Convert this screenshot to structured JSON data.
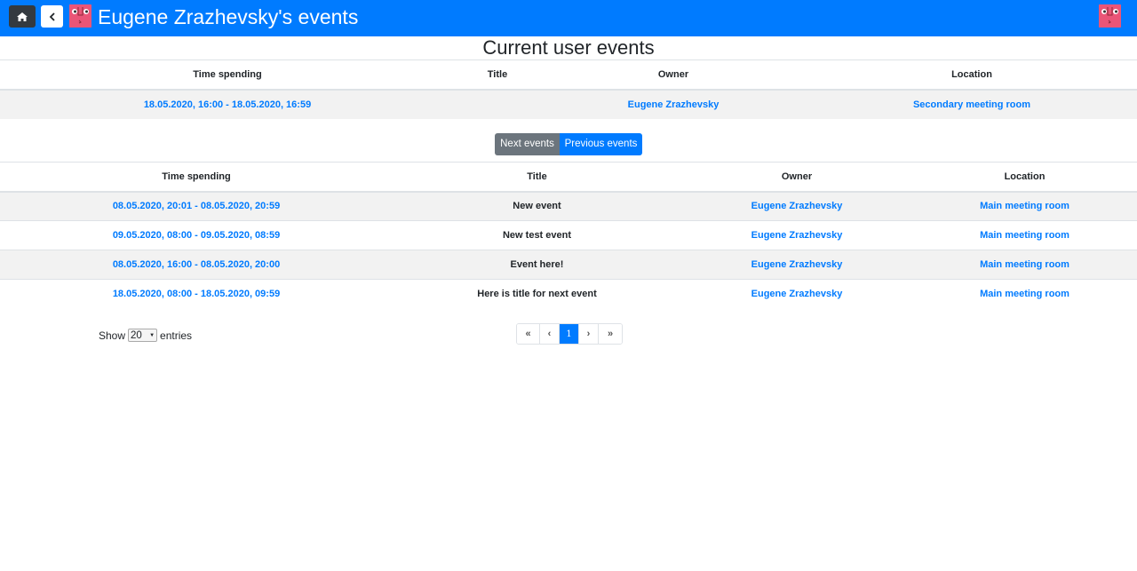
{
  "navbar": {
    "title": "Eugene Zrazhevsky's events",
    "home_icon": "home-icon",
    "back_icon": "chevron-left-icon",
    "bg_color": "#007bff"
  },
  "current": {
    "heading": "Current user events",
    "columns": [
      "Time spending",
      "Title",
      "Owner",
      "Location"
    ],
    "rows": [
      {
        "time": "18.05.2020, 16:00 - 18.05.2020, 16:59",
        "title": "",
        "owner": "Eugene Zrazhevsky",
        "location": "Secondary meeting room"
      }
    ]
  },
  "toggle": {
    "next_label": "Next events",
    "previous_label": "Previous events",
    "active": "previous"
  },
  "events": {
    "columns": [
      "Time spending",
      "Title",
      "Owner",
      "Location"
    ],
    "rows": [
      {
        "time": "08.05.2020, 20:01 - 08.05.2020, 20:59",
        "title": "New event",
        "owner": "Eugene Zrazhevsky",
        "location": "Main meeting room"
      },
      {
        "time": "09.05.2020, 08:00 - 09.05.2020, 08:59",
        "title": "New test event",
        "owner": "Eugene Zrazhevsky",
        "location": "Main meeting room"
      },
      {
        "time": "08.05.2020, 16:00 - 08.05.2020, 20:00",
        "title": "Event here!",
        "owner": "Eugene Zrazhevsky",
        "location": "Main meeting room"
      },
      {
        "time": "18.05.2020, 08:00 - 18.05.2020, 09:59",
        "title": "Here is title for next event",
        "owner": "Eugene Zrazhevsky",
        "location": "Main meeting room"
      }
    ]
  },
  "entries": {
    "show_label": "Show",
    "selected": "20",
    "entries_label": "entries"
  },
  "pagination": {
    "first": "«",
    "prev": "‹",
    "current_page": "1",
    "next": "›",
    "last": "»"
  }
}
